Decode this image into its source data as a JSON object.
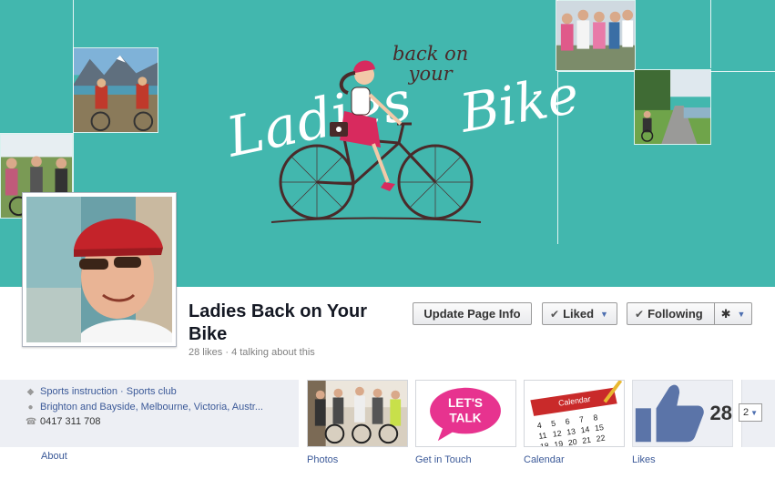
{
  "cover": {
    "logo": {
      "word1": "Ladies",
      "word2_line1": "back on",
      "word2_line2": "your",
      "word3": "Bike"
    },
    "background_color": "#42b7ae"
  },
  "page": {
    "title": "Ladies Back on Your Bike",
    "subtitle": "28 likes · 4 talking about this"
  },
  "actions": {
    "update_label": "Update Page Info",
    "liked_label": "Liked",
    "following_label": "Following",
    "settings_icon": "gear-icon"
  },
  "info": {
    "category": "Sports instruction · Sports club",
    "location": "Brighton and Bayside, Melbourne, Victoria, Austr...",
    "phone": "0417 311 708",
    "about_label": "About"
  },
  "apps": [
    {
      "label": "Photos"
    },
    {
      "label": "Get in Touch",
      "badge_text_line1": "LET'S",
      "badge_text_line2": "TALK"
    },
    {
      "label": "Calendar",
      "header_text": "Calendar"
    },
    {
      "label": "Likes",
      "count": "28"
    }
  ],
  "more": {
    "count": "2"
  },
  "colors": {
    "link": "#3b5998",
    "accent_teal": "#42b7ae",
    "talk_pink": "#e7338f"
  }
}
